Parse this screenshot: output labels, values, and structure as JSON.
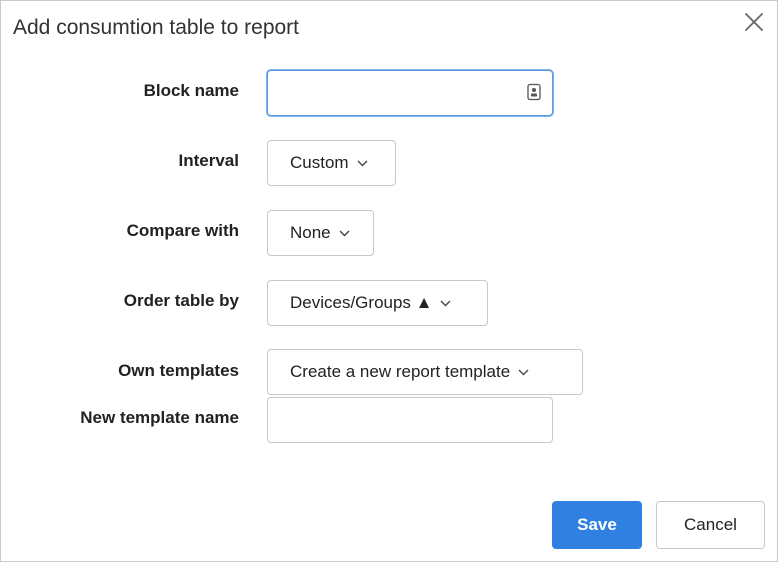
{
  "dialog": {
    "title": "Add consumtion table to report",
    "close_icon": "close-icon"
  },
  "form": {
    "block_name": {
      "label": "Block name",
      "value": "",
      "icon": "contact-card-icon"
    },
    "interval": {
      "label": "Interval",
      "selected": "Custom"
    },
    "compare_with": {
      "label": "Compare with",
      "selected": "None"
    },
    "order_table_by": {
      "label": "Order table by",
      "selected": "Devices/Groups ▲"
    },
    "own_templates": {
      "label": "Own templates",
      "selected": "Create a new report template"
    },
    "new_template_name": {
      "label": "New template name",
      "value": ""
    }
  },
  "footer": {
    "save_label": "Save",
    "cancel_label": "Cancel"
  },
  "colors": {
    "primary": "#2f80e0",
    "focus_border": "#5a9be0",
    "border": "#c8c8c8"
  }
}
